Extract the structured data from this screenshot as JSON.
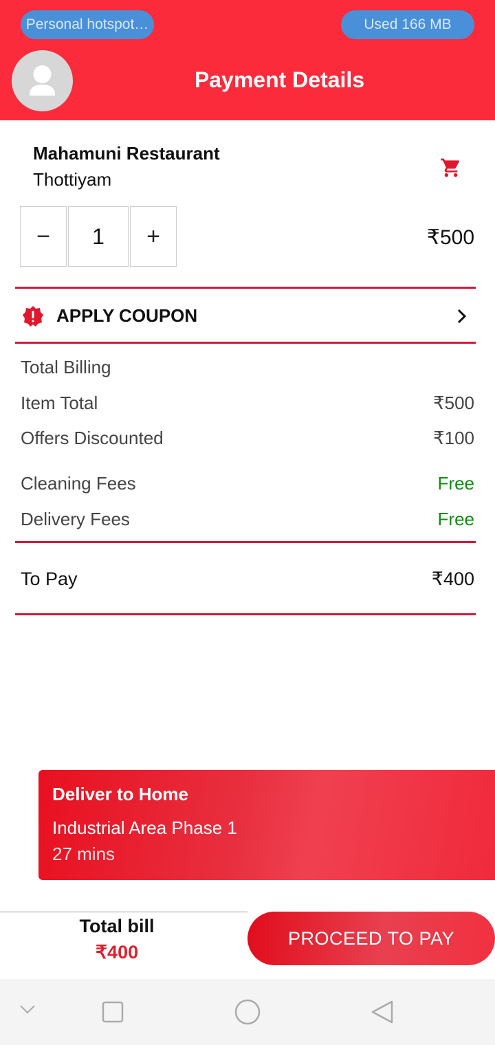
{
  "status_bar": {
    "hotspot_label": "Personal hotspot…",
    "data_usage": "Used  166 MB"
  },
  "header": {
    "title": "Payment Details"
  },
  "restaurant": {
    "name": "Mahamuni Restaurant",
    "location": "Thottiyam"
  },
  "stepper": {
    "minus": "−",
    "quantity": "1",
    "plus": "+"
  },
  "item_price": "₹500",
  "coupon": {
    "label": "APPLY COUPON"
  },
  "billing": {
    "heading": "Total Billing",
    "rows": [
      {
        "label": "Item Total",
        "value": "₹500"
      },
      {
        "label": "Offers Discounted",
        "value": "₹100"
      },
      {
        "label": "Cleaning Fees",
        "value": "Free"
      },
      {
        "label": "Delivery Fees",
        "value": "Free"
      }
    ],
    "to_pay_label": "To Pay",
    "to_pay_value": "₹400"
  },
  "delivery": {
    "title": "Deliver to Home",
    "address": "Industrial Area Phase 1",
    "eta": "27 mins"
  },
  "footer": {
    "total_label": "Total bill",
    "total_value": "₹400",
    "proceed_label": "PROCEED TO PAY"
  },
  "colors": {
    "header_red": "#fb2b3c",
    "divider_red": "#d01a3c",
    "free_green": "#138a13",
    "total_red": "#e02030",
    "pill_blue": "#4a90d9"
  },
  "icons": {
    "avatar": "user-avatar-icon",
    "cart": "cart-icon",
    "coupon": "discount-badge-icon",
    "chevron": "chevron-right-icon",
    "nav": [
      "chevron-down-icon",
      "square-icon",
      "circle-icon",
      "back-triangle-icon"
    ]
  }
}
